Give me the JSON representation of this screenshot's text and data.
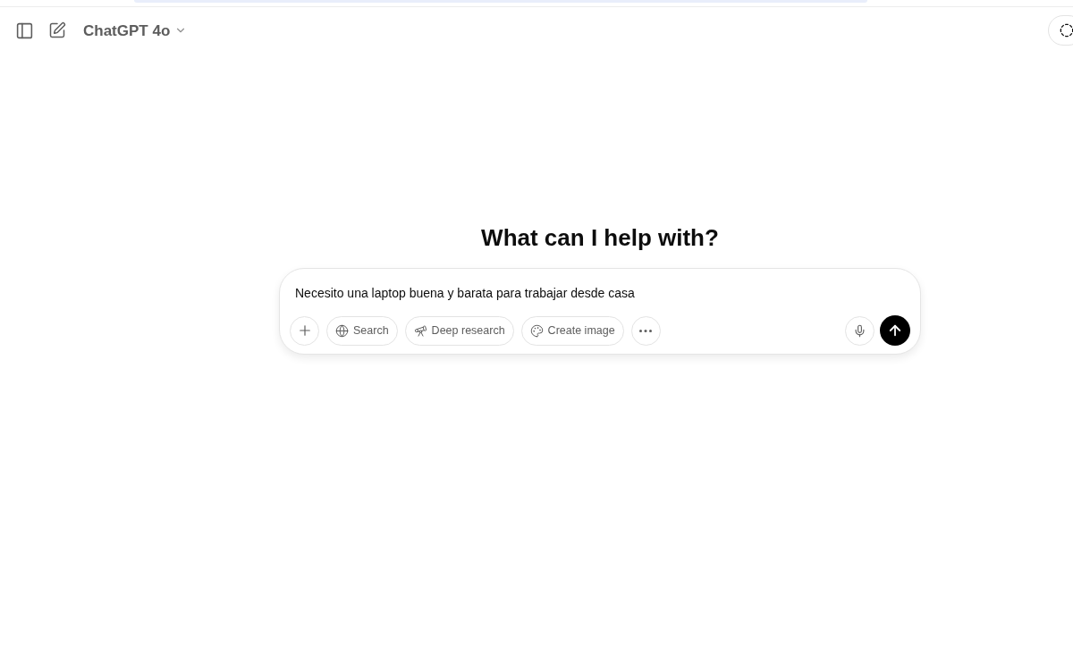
{
  "header": {
    "model": "ChatGPT 4o"
  },
  "heading": "What can I help with?",
  "composer": {
    "value": "Necesito una laptop buena y barata para trabajar desde casa",
    "tools": [
      {
        "kind": "globe",
        "label": "Search"
      },
      {
        "kind": "telescope",
        "label": "Deep research"
      },
      {
        "kind": "palette",
        "label": "Create image"
      }
    ]
  }
}
